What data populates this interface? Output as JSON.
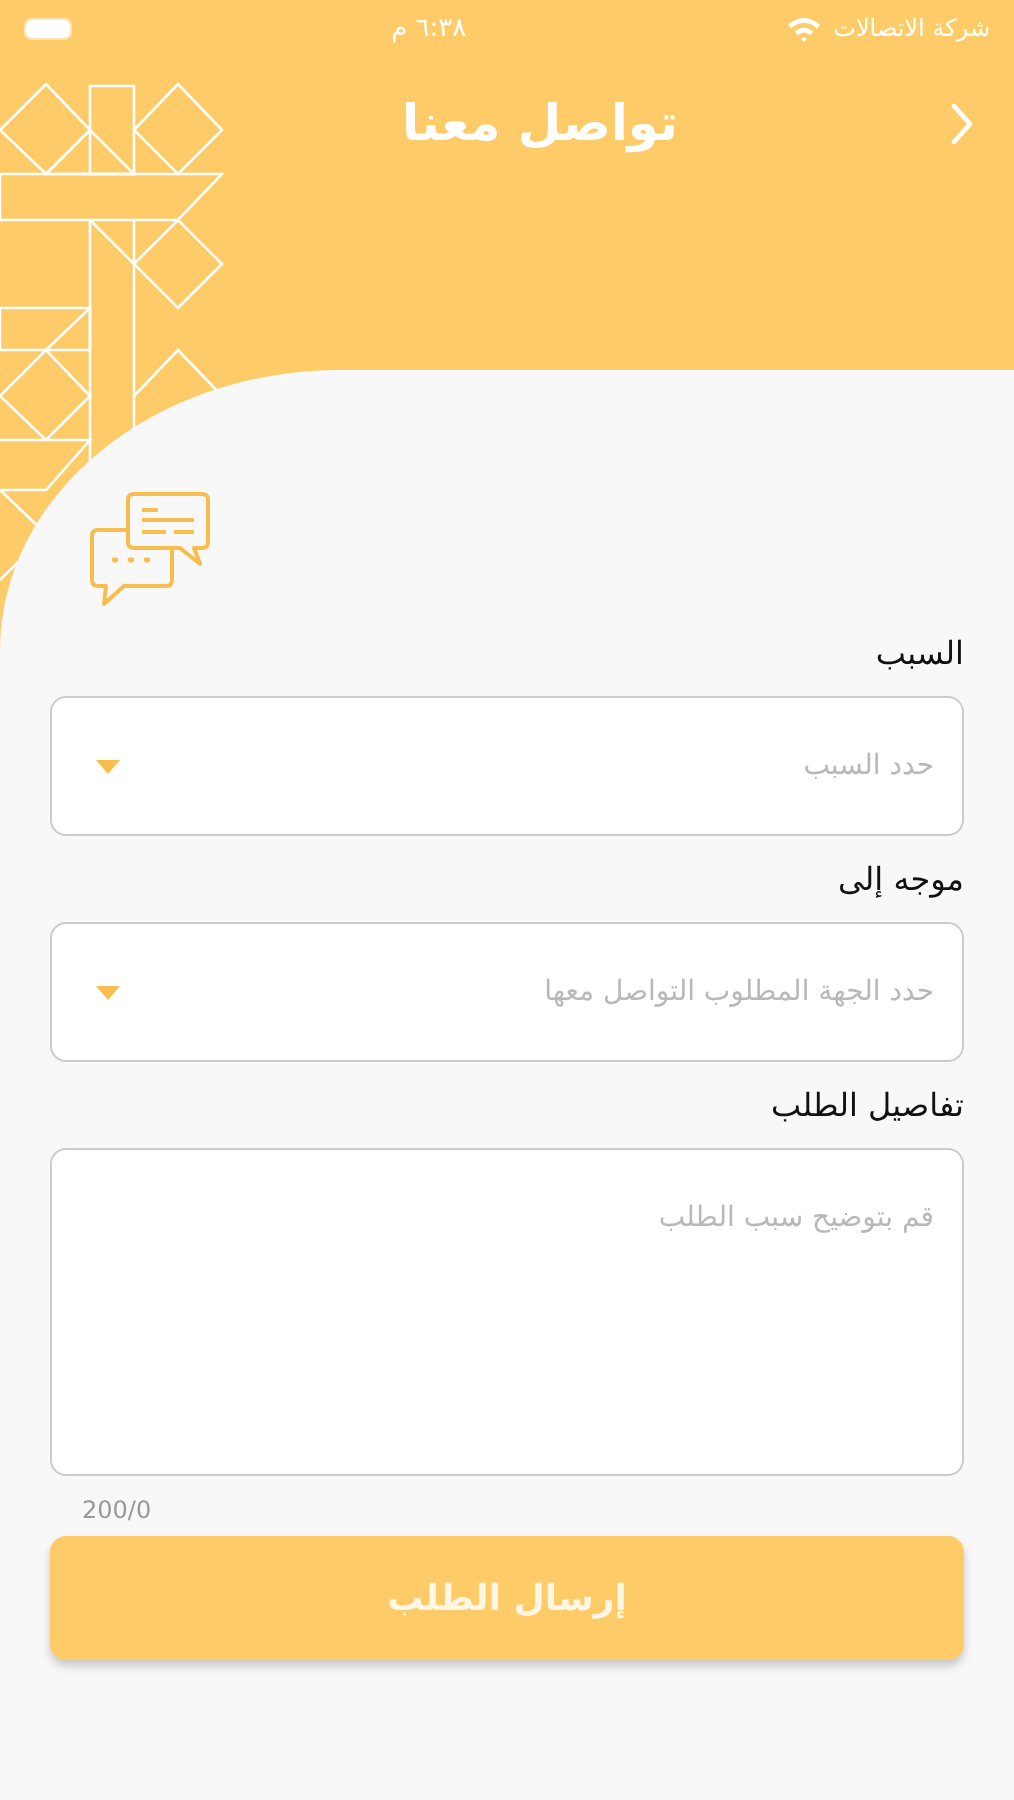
{
  "status_bar": {
    "carrier": "شركة الاتصالات",
    "time": "٦:٣٨ م"
  },
  "header": {
    "title": "تواصل معنا"
  },
  "form": {
    "fields": [
      {
        "kind": "select",
        "label": "السبب",
        "placeholder": "حدد السبب"
      },
      {
        "kind": "select",
        "label": "موجه إلى",
        "placeholder": "حدد الجهة المطلوب التواصل معها"
      },
      {
        "kind": "textarea",
        "label": "تفاصيل الطلب",
        "placeholder": "قم بتوضيح سبب الطلب",
        "counter": "200/0"
      }
    ],
    "submit": {
      "label": "إرسال الطلب",
      "disabled": true
    }
  }
}
